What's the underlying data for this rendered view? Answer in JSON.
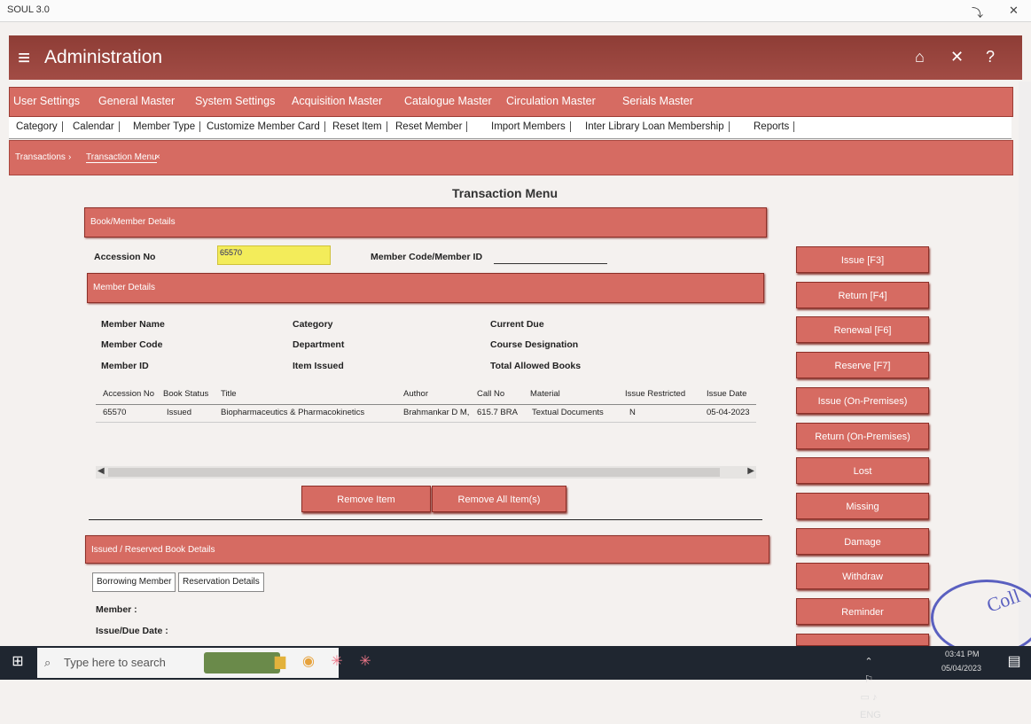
{
  "window": {
    "title": "SOUL 3.0"
  },
  "app": {
    "title": "Administration"
  },
  "menu": [
    "User Settings",
    "General Master",
    "System Settings",
    "Acquisition Master",
    "Catalogue Master",
    "Circulation Master",
    "Serials Master"
  ],
  "submenu": [
    "Category",
    "Calendar",
    "Member Type",
    "Customize Member Card",
    "Reset Item",
    "Reset Member",
    "Import Members",
    "Inter Library Loan Membership",
    "Reports"
  ],
  "breadcrumb": {
    "first": "Transactions",
    "second": "Transaction Menu"
  },
  "page": {
    "title": "Transaction Menu"
  },
  "sections": {
    "book_member": "Book/Member Details",
    "member": "Member Details",
    "issued_reserved": "Issued / Reserved Book Details"
  },
  "form": {
    "accession_label": "Accession No",
    "accession_value": "65570",
    "member_code_label": "Member Code/Member ID"
  },
  "member_labels": [
    "Member Name",
    "Member Code",
    "Member ID",
    "Category",
    "Department",
    "Item Issued",
    "Current Due",
    "Course Designation",
    "Total Allowed Books"
  ],
  "table": {
    "headers": [
      "Accession No",
      "Book Status",
      "Title",
      "Author",
      "Call No",
      "Material",
      "Issue Restricted",
      "Issue Date"
    ],
    "rows": [
      [
        "65570",
        "Issued",
        "Biopharmaceutics & Pharmacokinetics",
        "Brahmankar D M,",
        "615.7 BRA",
        "Textual Documents",
        "N",
        "05-04-2023"
      ]
    ]
  },
  "buttons": {
    "remove_item": "Remove Item",
    "remove_all": "Remove All Item(s)",
    "right": [
      "Issue [F3]",
      "Return [F4]",
      "Renewal [F6]",
      "Reserve [F7]",
      "Issue (On-Premises)",
      "Return (On-Premises)",
      "Lost",
      "Missing",
      "Damage",
      "Withdraw",
      "Reminder"
    ]
  },
  "subtabs": [
    "Borrowing Member",
    "Reservation Details"
  ],
  "bottom_labels": {
    "member": "Member :",
    "issue_due": "Issue/Due Date :"
  },
  "taskbar": {
    "search_placeholder": "Type here to search",
    "time": "03:41 PM",
    "date": "05/04/2023"
  },
  "stamp": {
    "text": "Coll"
  }
}
